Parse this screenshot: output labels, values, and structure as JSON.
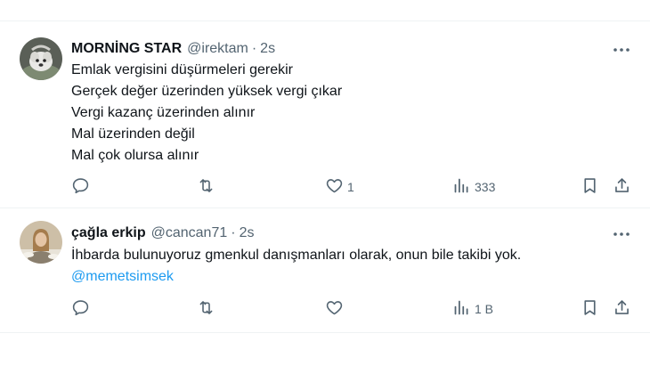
{
  "tweets": [
    {
      "display_name": "MORNİNG STAR",
      "handle": "@irektam",
      "separator": "·",
      "time": "2s",
      "avatar_icon": "profile-photo-dog",
      "lines": [
        "Emlak vergisini düşürmeleri gerekir",
        "Gerçek değer üzerinden yüksek vergi çıkar",
        "Vergi kazanç üzerinden alınır",
        "Mal üzerinden değil",
        "Mal çok olursa alınır"
      ],
      "stats": {
        "replies": "",
        "retweets": "",
        "likes": "1",
        "views": "333"
      }
    },
    {
      "display_name": "çağla erkip",
      "handle": "@cancan71",
      "separator": "·",
      "time": "2s",
      "avatar_icon": "profile-photo-person",
      "lines": [
        "İhbarda bulunuyoruz gmenkul danışmanları olarak, onun bile takibi yok."
      ],
      "mention": "@memetsimsek",
      "stats": {
        "replies": "",
        "retweets": "",
        "likes": "",
        "views": "1 B"
      }
    }
  ],
  "colors": {
    "text": "#0f1419",
    "secondary": "#536471",
    "link": "#1d9bf0",
    "divider": "#eff3f4"
  },
  "icons": [
    "more-icon",
    "reply-icon",
    "retweet-icon",
    "like-icon",
    "views-icon",
    "bookmark-icon",
    "share-icon"
  ]
}
